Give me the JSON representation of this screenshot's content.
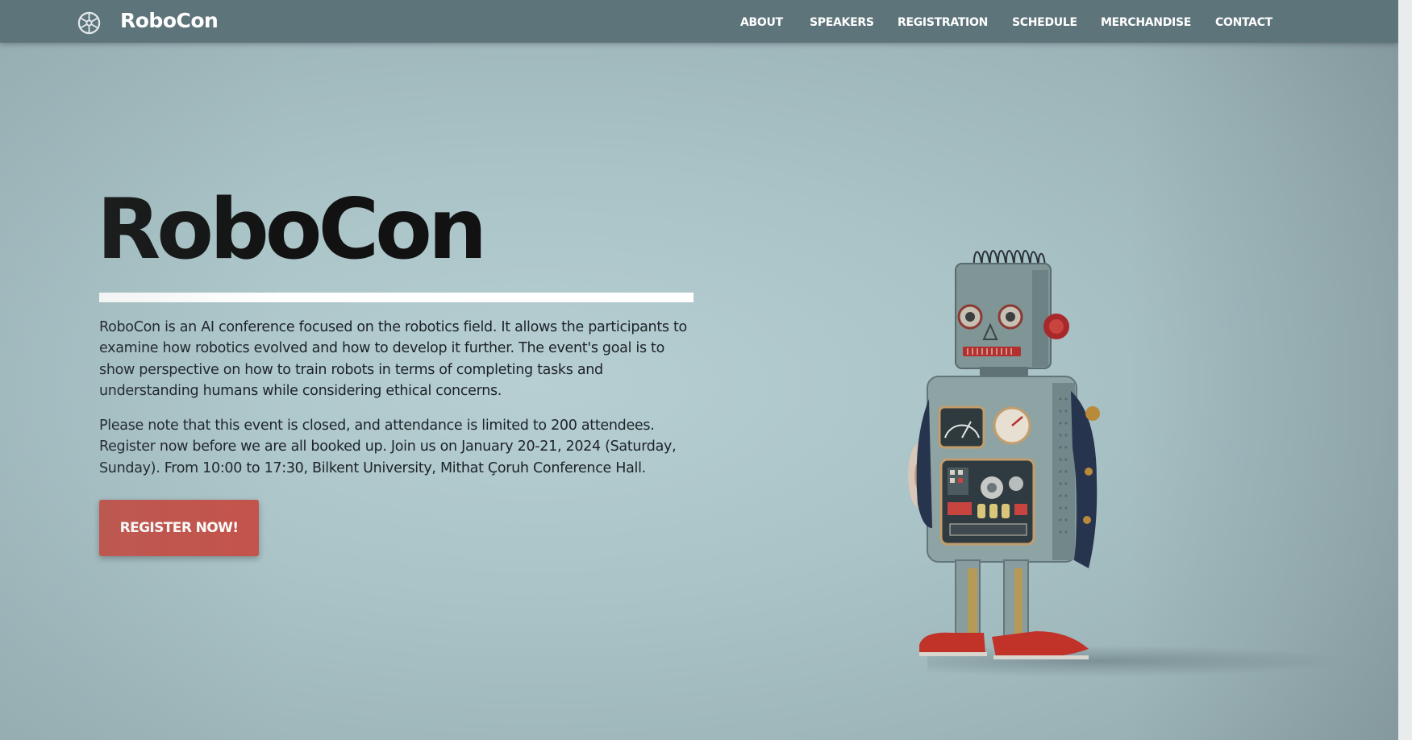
{
  "navbar": {
    "brand": "RoboCon",
    "logo_icon": "gear-wheel-icon",
    "items": [
      {
        "label": "ABOUT"
      },
      {
        "label": "SPEAKERS"
      },
      {
        "label": "REGISTRATION"
      },
      {
        "label": "SCHEDULE"
      },
      {
        "label": "MERCHANDISE"
      },
      {
        "label": "CONTACT"
      }
    ]
  },
  "hero": {
    "title": "RoboCon",
    "paragraph_1": "RoboCon is an AI conference focused on the robotics field. It allows the participants to examine how robotics evolved and how to develop it further. The event's goal is to show perspective on how to train robots in terms of completing tasks and understanding humans while considering ethical concerns.",
    "paragraph_2": "Please note that this event is closed, and attendance is limited to 200 attendees. Register now before we are all booked up. Join us on January 20-21, 2024 (Saturday, Sunday). From 10:00 to 17:30, Bilkent University, Mithat Çoruh Conference Hall.",
    "cta_label": "REGISTER NOW!",
    "image_icon": "toy-robot-illustration"
  },
  "colors": {
    "navbar_bg": "#5d747a",
    "cta_bg": "#c4534a",
    "title": "#121212",
    "background": "#b7cfd3"
  }
}
